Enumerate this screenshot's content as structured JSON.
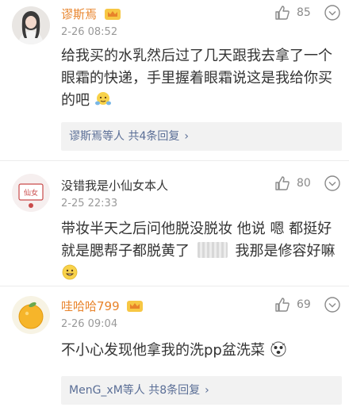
{
  "comments": [
    {
      "username": "谬斯焉",
      "timestamp": "2-26 08:52",
      "likes": "85",
      "content_line1": "给我买的水乳然后过了几天跟我去拿了一个",
      "content_line2": "眼霜的快递，手里握着眼霜说这是我给你买",
      "content_line3": "的吧",
      "reply_summary": "谬斯焉等人  共4条回复",
      "avatar_icon": "girl-portrait-avatar",
      "content_emoji": "hug-emoji"
    },
    {
      "username": "没错我是小仙女本人",
      "timestamp": "2-25 22:33",
      "likes": "80",
      "content_line1": "带妆半天之后问他脱没脱妆  他说 嗯 都挺好",
      "content_line2_a": "就是腮帮子都脱黄了",
      "content_line2_b": "我那是修容好嘛",
      "avatar_label": "仙女",
      "avatar_icon": "badge-avatar",
      "content_emoji": "grin-emoji"
    },
    {
      "username": "哇哈哈799",
      "timestamp": "2-26 09:04",
      "likes": "69",
      "content_line1": "不小心发现他拿我的洗pp盆洗菜",
      "reply_summary": "MenG_xM等人  共8条回复",
      "avatar_icon": "orange-fruit-avatar",
      "content_emoji": "shocked-emoji"
    }
  ],
  "colors": {
    "username_highlight": "#e8832a",
    "reply_link": "#5a6e96",
    "meta_gray": "#999999"
  }
}
